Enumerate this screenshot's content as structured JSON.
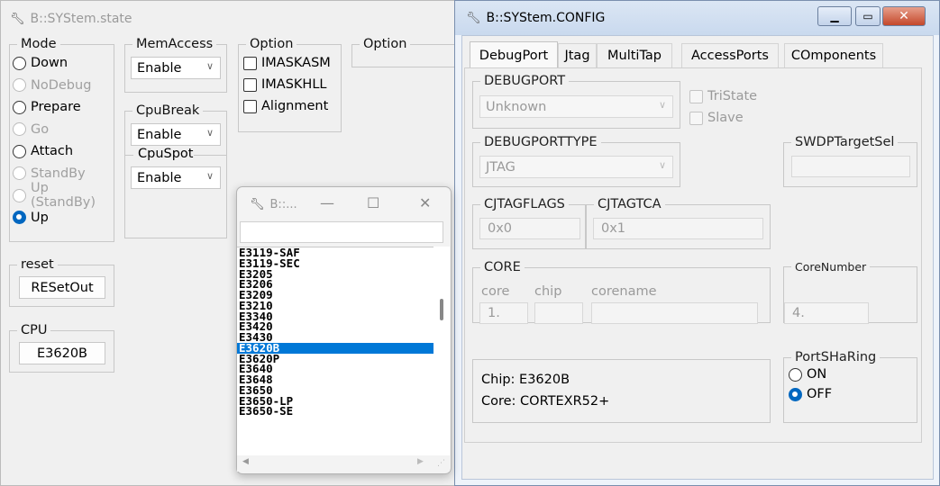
{
  "state_window": {
    "title": "B::SYStem.state",
    "mode": {
      "legend": "Mode",
      "items": [
        {
          "label": "Down",
          "enabled": true,
          "selected": false
        },
        {
          "label": "NoDebug",
          "enabled": false,
          "selected": false
        },
        {
          "label": "Prepare",
          "enabled": true,
          "selected": false
        },
        {
          "label": "Go",
          "enabled": false,
          "selected": false
        },
        {
          "label": "Attach",
          "enabled": true,
          "selected": false
        },
        {
          "label": "StandBy",
          "enabled": false,
          "selected": false
        },
        {
          "label": "Up (StandBy)",
          "enabled": false,
          "selected": false
        },
        {
          "label": "Up",
          "enabled": true,
          "selected": true
        }
      ]
    },
    "memaccess": {
      "legend": "MemAccess",
      "value": "Enable"
    },
    "cpubreak": {
      "legend": "CpuBreak",
      "value": "Enable"
    },
    "cpuspot": {
      "legend": "CpuSpot",
      "value": "Enable"
    },
    "option1": {
      "legend": "Option",
      "checks": [
        {
          "label": "IMASKASM",
          "checked": false
        },
        {
          "label": "IMASKHLL",
          "checked": false
        },
        {
          "label": "Alignment",
          "checked": false
        }
      ]
    },
    "option2": {
      "legend": "Option"
    },
    "reset": {
      "legend": "reset",
      "button": "RESetOut"
    },
    "cpu": {
      "legend": "CPU",
      "button": "E3620B"
    }
  },
  "list_window": {
    "title": "B::...",
    "minimize": "—",
    "maximize": "☐",
    "close": "✕",
    "search_value": "",
    "items": [
      "E3119-SAF",
      "E3119-SEC",
      "E3205",
      "E3206",
      "E3209",
      "E3210",
      "E3340",
      "E3420",
      "E3430",
      "E3620B",
      "E3620P",
      "E3640",
      "E3648",
      "E3650",
      "E3650-LP",
      "E3650-SE"
    ],
    "selected": "E3620B",
    "scroll_left": "◀",
    "scroll_right": "▶"
  },
  "config_window": {
    "title": "B::SYStem.CONFIG",
    "tabs": [
      {
        "label": "DebugPort",
        "active": true
      },
      {
        "label": "Jtag",
        "active": false
      },
      {
        "label": "MultiTap",
        "active": false
      },
      {
        "label": "AccessPorts",
        "active": false
      },
      {
        "label": "COmponents",
        "active": false
      }
    ],
    "debugport": {
      "legend": "DEBUGPORT",
      "value": "Unknown"
    },
    "tristate": "TriState",
    "slave": "Slave",
    "debugporttype": {
      "legend": "DEBUGPORTTYPE",
      "value": "JTAG"
    },
    "swdp": {
      "legend": "SWDPTargetSel",
      "value": ""
    },
    "cjtagflags": {
      "legend": "CJTAGFLAGS",
      "value": "0x0"
    },
    "cjtagtca": {
      "legend": "CJTAGTCA",
      "value": "0x1"
    },
    "core": {
      "legend": "CORE",
      "col_core": "core",
      "col_chip": "chip",
      "col_corename": "corename",
      "core_value": "1.",
      "chip_value": "",
      "corename_value": ""
    },
    "corenumber": {
      "legend": "CoreNumber",
      "value": "4."
    },
    "info": {
      "chip": "Chip: E3620B",
      "core": "Core: CORTEXR52+"
    },
    "portsharing": {
      "legend": "PortSHaRing",
      "items": [
        {
          "label": "ON",
          "selected": false
        },
        {
          "label": "OFF",
          "selected": true
        }
      ]
    }
  }
}
